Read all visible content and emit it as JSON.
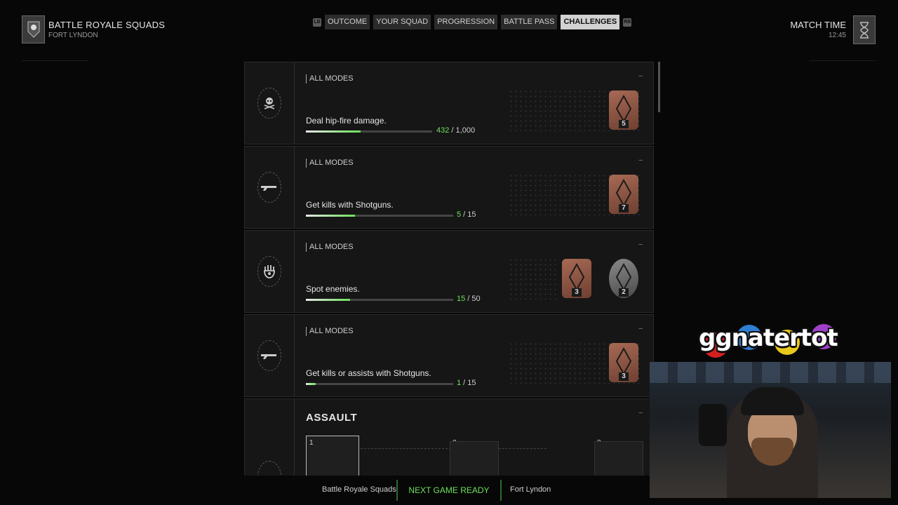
{
  "header": {
    "mode_title": "BATTLE ROYALE SQUADS",
    "mode_sub": "FORT LYNDON",
    "tabs_left_hint": "LB",
    "tabs_right_hint": "RB",
    "tabs": [
      "OUTCOME",
      "YOUR SQUAD",
      "PROGRESSION",
      "BATTLE PASS",
      "CHALLENGES"
    ],
    "active_tab": "CHALLENGES",
    "match_time_label": "MATCH TIME",
    "match_time_value": "12:45"
  },
  "challenges": [
    {
      "category": "ALL MODES",
      "description": "Deal hip-fire damage.",
      "current": "432",
      "total": "1,000",
      "progress": 0.432,
      "icon": "skull-crossbones-icon",
      "rewards": [
        {
          "tier": "bronze",
          "level": "5"
        }
      ]
    },
    {
      "category": "ALL MODES",
      "description": "Get kills with Shotguns.",
      "current": "5",
      "total": "15",
      "progress": 0.333,
      "icon": "shotgun-icon",
      "rewards": [
        {
          "tier": "bronze",
          "level": "7"
        }
      ]
    },
    {
      "category": "ALL MODES",
      "description": "Spot enemies.",
      "current": "15",
      "total": "50",
      "progress": 0.3,
      "icon": "hand-eye-icon",
      "rewards": [
        {
          "tier": "bronze",
          "level": "3"
        },
        {
          "tier": "silver",
          "level": "2"
        }
      ]
    },
    {
      "category": "ALL MODES",
      "description": "Get kills or assists with Shotguns.",
      "current": "1",
      "total": "15",
      "progress": 0.067,
      "icon": "shotgun-icon",
      "rewards": [
        {
          "tier": "bronze",
          "level": "3"
        }
      ]
    }
  ],
  "assault": {
    "title": "ASSAULT",
    "tiers": [
      "1",
      "2",
      "3"
    ]
  },
  "footer": {
    "mode": "Battle Royale Squads",
    "ready": "NEXT GAME READY",
    "map": "Fort Lyndon"
  },
  "overlay": {
    "logo": "ggnatertot"
  },
  "colors": {
    "accent_green": "#6ee05c",
    "bronze": "#a86a55",
    "silver": "#8a8a8a"
  }
}
